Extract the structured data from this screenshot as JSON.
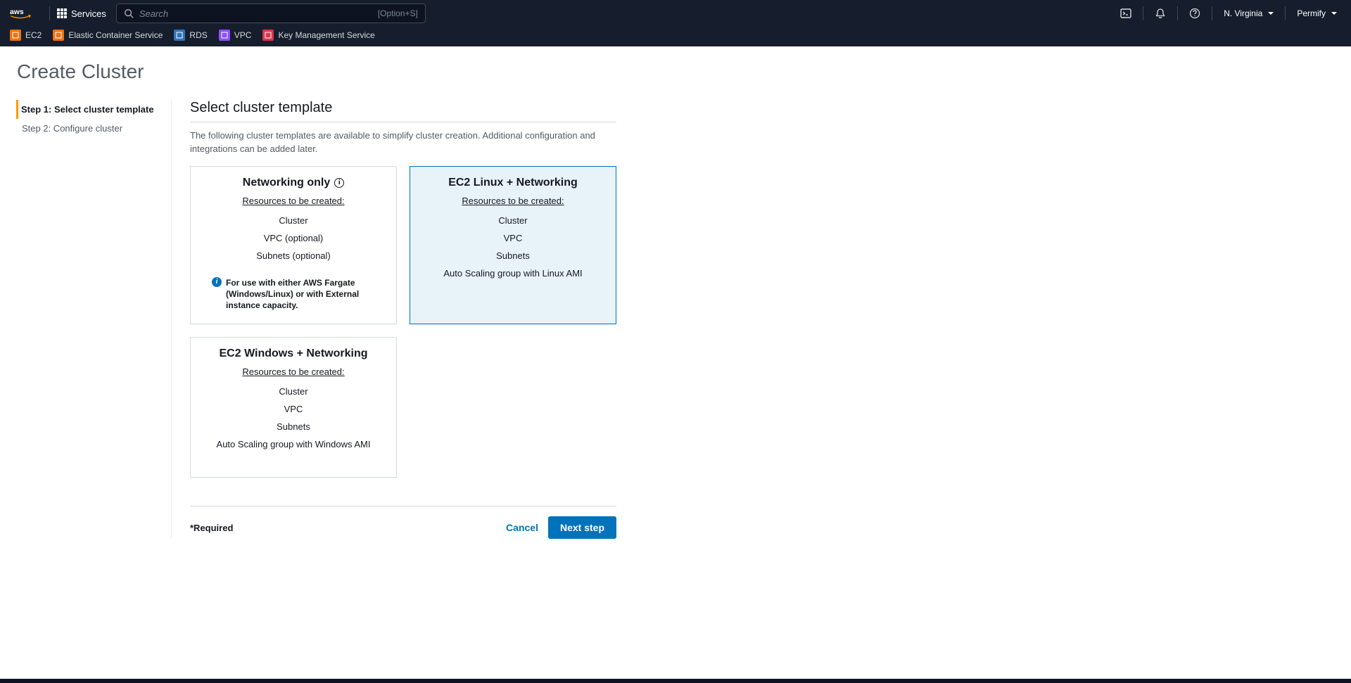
{
  "topnav": {
    "services_label": "Services",
    "search_placeholder": "Search",
    "search_shortcut": "[Option+S]",
    "region": "N. Virginia",
    "account": "Permify"
  },
  "service_shortcuts": [
    {
      "label": "EC2",
      "color": "#ec7211"
    },
    {
      "label": "Elastic Container Service",
      "color": "#ec7211"
    },
    {
      "label": "RDS",
      "color": "#2e73b8"
    },
    {
      "label": "VPC",
      "color": "#8c4fff"
    },
    {
      "label": "Key Management Service",
      "color": "#dd344c"
    }
  ],
  "page_title": "Create Cluster",
  "steps": [
    {
      "label": "Step 1: Select cluster template",
      "active": true
    },
    {
      "label": "Step 2: Configure cluster",
      "active": false
    }
  ],
  "main": {
    "title": "Select cluster template",
    "description": "The following cluster templates are available to simplify cluster creation. Additional configuration and integrations can be added later.",
    "resources_label": "Resources to be created:"
  },
  "cards": [
    {
      "title": "Networking only",
      "has_info": true,
      "selected": false,
      "resources": [
        "Cluster",
        "VPC (optional)",
        "Subnets (optional)"
      ],
      "note": "For use with either AWS Fargate (Windows/Linux) or with External instance capacity."
    },
    {
      "title": "EC2 Linux + Networking",
      "has_info": false,
      "selected": true,
      "resources": [
        "Cluster",
        "VPC",
        "Subnets",
        "Auto Scaling group with Linux AMI"
      ],
      "note": null
    },
    {
      "title": "EC2 Windows + Networking",
      "has_info": false,
      "selected": false,
      "resources": [
        "Cluster",
        "VPC",
        "Subnets",
        "Auto Scaling group with Windows AMI"
      ],
      "note": null
    }
  ],
  "footer": {
    "required_text": "*Required",
    "cancel": "Cancel",
    "next": "Next step"
  }
}
